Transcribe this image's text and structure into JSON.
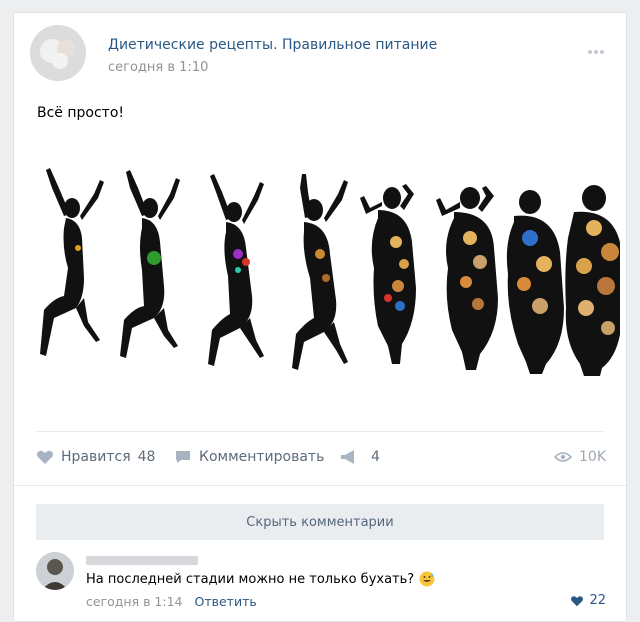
{
  "post": {
    "author": "Диетические рецепты. Правильное питание",
    "time": "сегодня в 1:10",
    "text": "Всё просто!"
  },
  "actions": {
    "like_label": "Нравится",
    "like_count": "48",
    "comment_label": "Комментировать",
    "share_count": "4",
    "views": "10K"
  },
  "comments": {
    "hide_label": "Скрыть комментарии",
    "items": [
      {
        "text": "На последней стадии можно  не  только бухать?",
        "time": "сегодня в 1:14",
        "reply_label": "Ответить",
        "likes": "22"
      }
    ]
  },
  "colors": {
    "link": "#2a5885",
    "muted": "#939393",
    "bg": "#edeef0"
  }
}
